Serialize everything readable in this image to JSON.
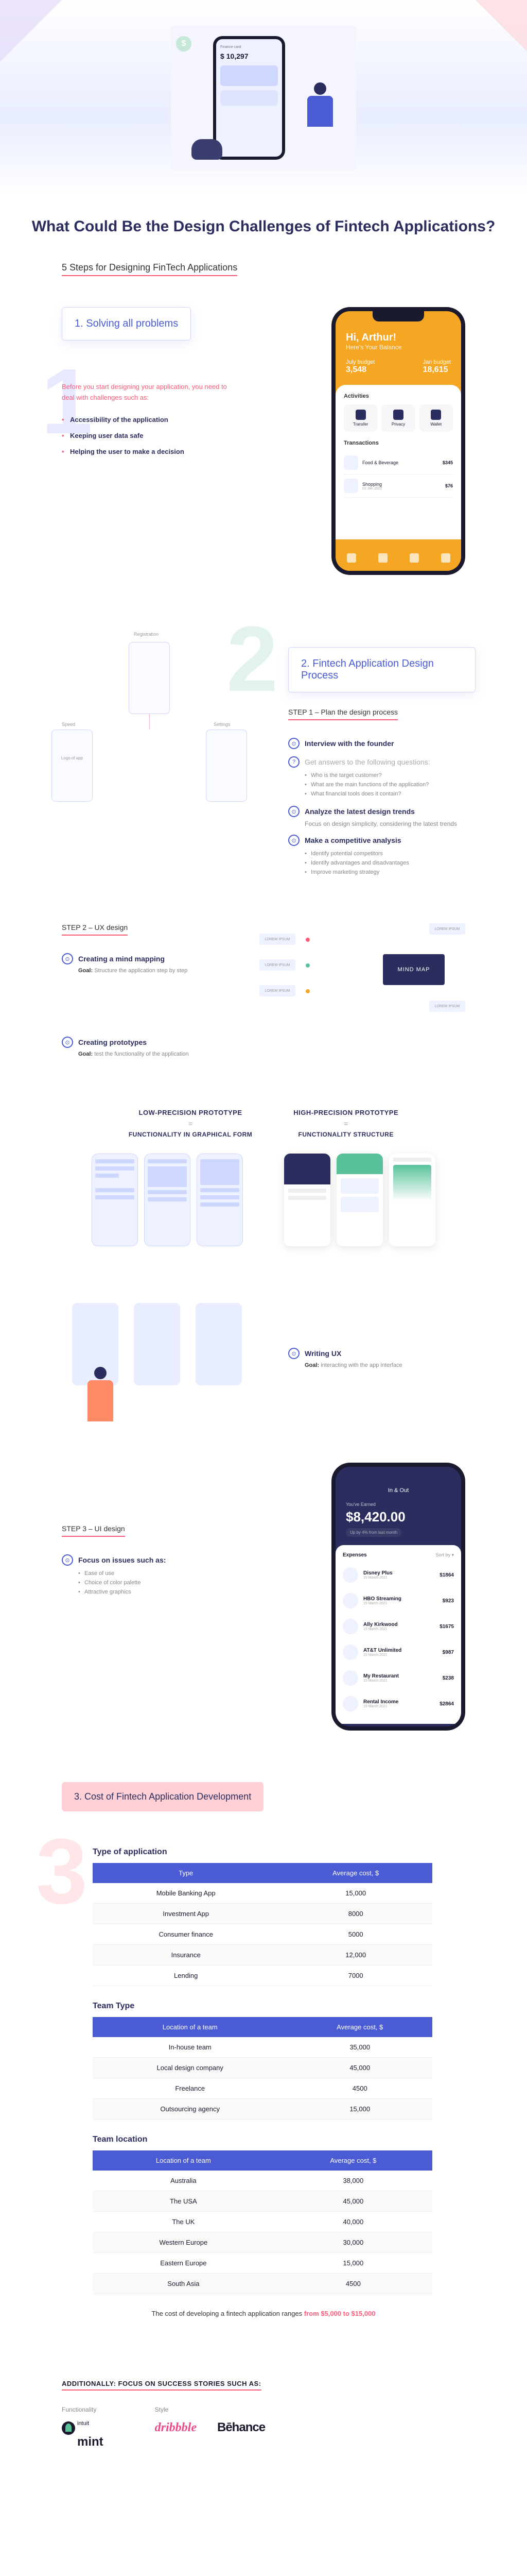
{
  "hero": {
    "phone_title": "Finance card",
    "phone_balance": "$ 10,297"
  },
  "title": "What Could Be the Design Challenges\nof Fintech Applications?",
  "subtitle": "5 Steps for Designing FinTech Applications",
  "section1": {
    "heading": "1. Solving all problems",
    "intro": "Before you start designing your application, you need to deal with challenges such as:",
    "bullets": [
      "Accessibility of the application",
      "Keeping user data safe",
      "Helping the user to make a decision"
    ],
    "phone": {
      "greeting": "Hi, Arthur!",
      "greeting_sub": "Here's Your Balance",
      "bal1_label": "July budget",
      "bal1_val": "3,548",
      "bal2_label": "Jan budget",
      "bal2_val": "18,615",
      "activities_label": "Activities",
      "activities": [
        "Transfer",
        "Privacy",
        "Wallet"
      ],
      "transactions_label": "Transactions",
      "trans": [
        {
          "name": "Food & Beverage",
          "date": "",
          "amt": "$345"
        },
        {
          "name": "Shopping",
          "date": "02 Jan 2022",
          "amt": "$76"
        }
      ]
    }
  },
  "section2": {
    "heading": "2. Fintech Application Design Process",
    "wf_labels": {
      "top": "Registration",
      "left": "Speed",
      "leftbox": "Logo of app",
      "right": "Settings"
    },
    "step1": "STEP 1 – Plan the design process",
    "items": [
      {
        "icon": "⊙",
        "title": "Interview with the founder"
      },
      {
        "icon": "?",
        "title": "Get answers to the following questions:",
        "qa": [
          "Who is the target customer?",
          "What are the main functions of the application?",
          "What financial tools does it contain?"
        ]
      },
      {
        "icon": "⊙",
        "title": "Analyze the latest design trends",
        "desc": "Focus on design simplicity, considering the latest trends"
      },
      {
        "icon": "⊙",
        "title": "Make a competitive analysis",
        "qa": [
          "Identify potential competitors",
          "Identify advantages and disadvantages",
          "Improve marketing strategy"
        ]
      }
    ]
  },
  "step2": {
    "label": "STEP 2 – UX design",
    "mind_title": "Creating a mind mapping",
    "mind_goal_label": "Goal:",
    "mind_goal": "Structure the application step by step",
    "mindmap_center": "MIND MAP",
    "mindmap_node": "LOREM IPSUM",
    "proto_title": "Creating prototypes",
    "proto_goal_label": "Goal:",
    "proto_goal": "test the functionality of the application",
    "low_h": "LOW-PRECISION PROTOTYPE",
    "eq": "=",
    "low_sub": "FUNCTIONALITY IN GRAPHICAL FORM",
    "high_h": "HIGH-PRECISION PROTOTYPE",
    "high_sub": "FUNCTIONALITY STRUCTURE",
    "ux_title": "Writing UX",
    "ux_goal_label": "Goal:",
    "ux_goal": "interacting with the app interface"
  },
  "step3": {
    "label": "STEP 3 – UI design",
    "focus_title": "Focus on issues such as:",
    "focus_items": [
      "Ease of use",
      "Choice of color palette",
      "Attractive graphics"
    ],
    "phone": {
      "app": "In & Out",
      "sub": "You've Earned",
      "amount": "$8,420.00",
      "note": "Up by 4% from last month",
      "section": "Expenses",
      "sort": "Sort by ▾",
      "rows": [
        {
          "name": "Disney Plus",
          "date": "15 March 2021",
          "val": "$1864"
        },
        {
          "name": "HBO Streaming",
          "date": "15 March 2021",
          "val": "$923"
        },
        {
          "name": "Ally Kirkwood",
          "date": "15 March 2021",
          "val": "$1675"
        },
        {
          "name": "AT&T Unlimited",
          "date": "15 March 2021",
          "val": "$987"
        },
        {
          "name": "My Restaurant",
          "date": "15 March 2021",
          "val": "$238"
        },
        {
          "name": "Rental Income",
          "date": "15 March 2021",
          "val": "$2864"
        }
      ]
    }
  },
  "cost": {
    "heading": "3. Cost of Fintech Application Development",
    "type_head": "Type of application",
    "type_cols": [
      "Type",
      "Average cost, $"
    ],
    "type_rows": [
      [
        "Mobile Banking App",
        "15,000"
      ],
      [
        "Investment App",
        "8000"
      ],
      [
        "Consumer finance",
        "5000"
      ],
      [
        "Insurance",
        "12,000"
      ],
      [
        "Lending",
        "7000"
      ]
    ],
    "team_head": "Team Type",
    "team_cols": [
      "Location of a team",
      "Average cost, $"
    ],
    "team_rows": [
      [
        "In-house team",
        "35,000"
      ],
      [
        "Local design company",
        "45,000"
      ],
      [
        "Freelance",
        "4500"
      ],
      [
        "Outsourcing agency",
        "15,000"
      ]
    ],
    "loc_head": "Team location",
    "loc_cols": [
      "Location of a team",
      "Average cost, $"
    ],
    "loc_rows": [
      [
        "Australia",
        "38,000"
      ],
      [
        "The USA",
        "45,000"
      ],
      [
        "The UK",
        "40,000"
      ],
      [
        "Western Europe",
        "30,000"
      ],
      [
        "Eastern Europe",
        "15,000"
      ],
      [
        "South Asia",
        "4500"
      ]
    ],
    "note_pre": "The cost of developing a fintech application ranges ",
    "note_highlight": "from $5,000 to $15,000"
  },
  "success": {
    "heading": "ADDITIONALLY: FOCUS ON SUCCESS STORIES SUCH AS:",
    "func_label": "Functionality",
    "style_label": "Style",
    "mint_pre": "intuit",
    "mint": "mint",
    "dribbble": "dribbble",
    "behance": "Bēhance"
  }
}
